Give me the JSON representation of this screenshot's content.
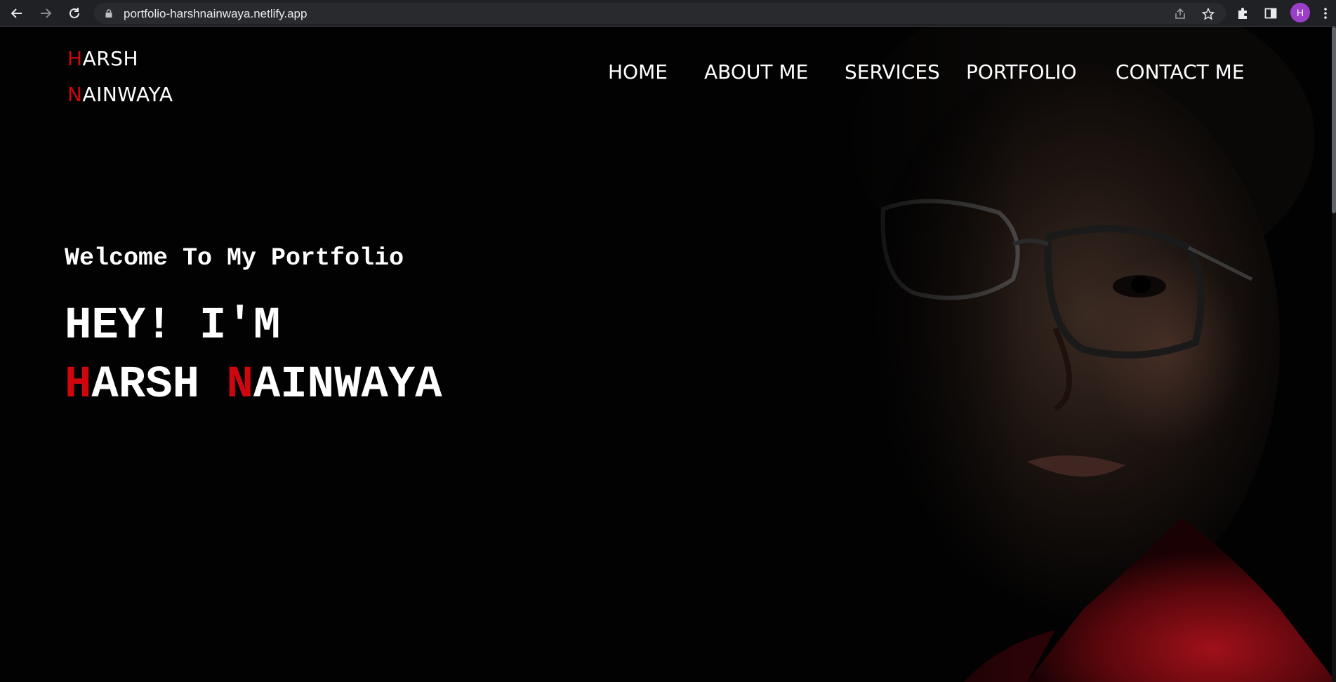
{
  "browser": {
    "url": "portfolio-harshnainwaya.netlify.app",
    "avatar_initial": "H",
    "icons": [
      "back-icon",
      "forward-icon",
      "reload-icon",
      "lock-icon",
      "share-icon",
      "bookmark-star-icon",
      "extensions-icon",
      "side-panel-icon",
      "more-icon"
    ]
  },
  "header": {
    "logo_first_initial": "H",
    "logo_first_rest": "ARSH",
    "logo_last_initial": "N",
    "logo_last_rest": "AINWAYA",
    "nav": [
      {
        "label": "HOME"
      },
      {
        "label": "ABOUT ME"
      },
      {
        "label": "SERVICES"
      },
      {
        "label": "PORTFOLIO"
      },
      {
        "label": "CONTACT ME"
      }
    ]
  },
  "hero": {
    "welcome": "Welcome To My Portfolio",
    "greeting": "HEY! I'M",
    "first_initial": "H",
    "first_rest": "ARSH",
    "last_initial": "N",
    "last_rest": "AINWAYA"
  },
  "colors": {
    "accent": "#d0060f",
    "background": "#020202",
    "text": "#ffffff"
  }
}
